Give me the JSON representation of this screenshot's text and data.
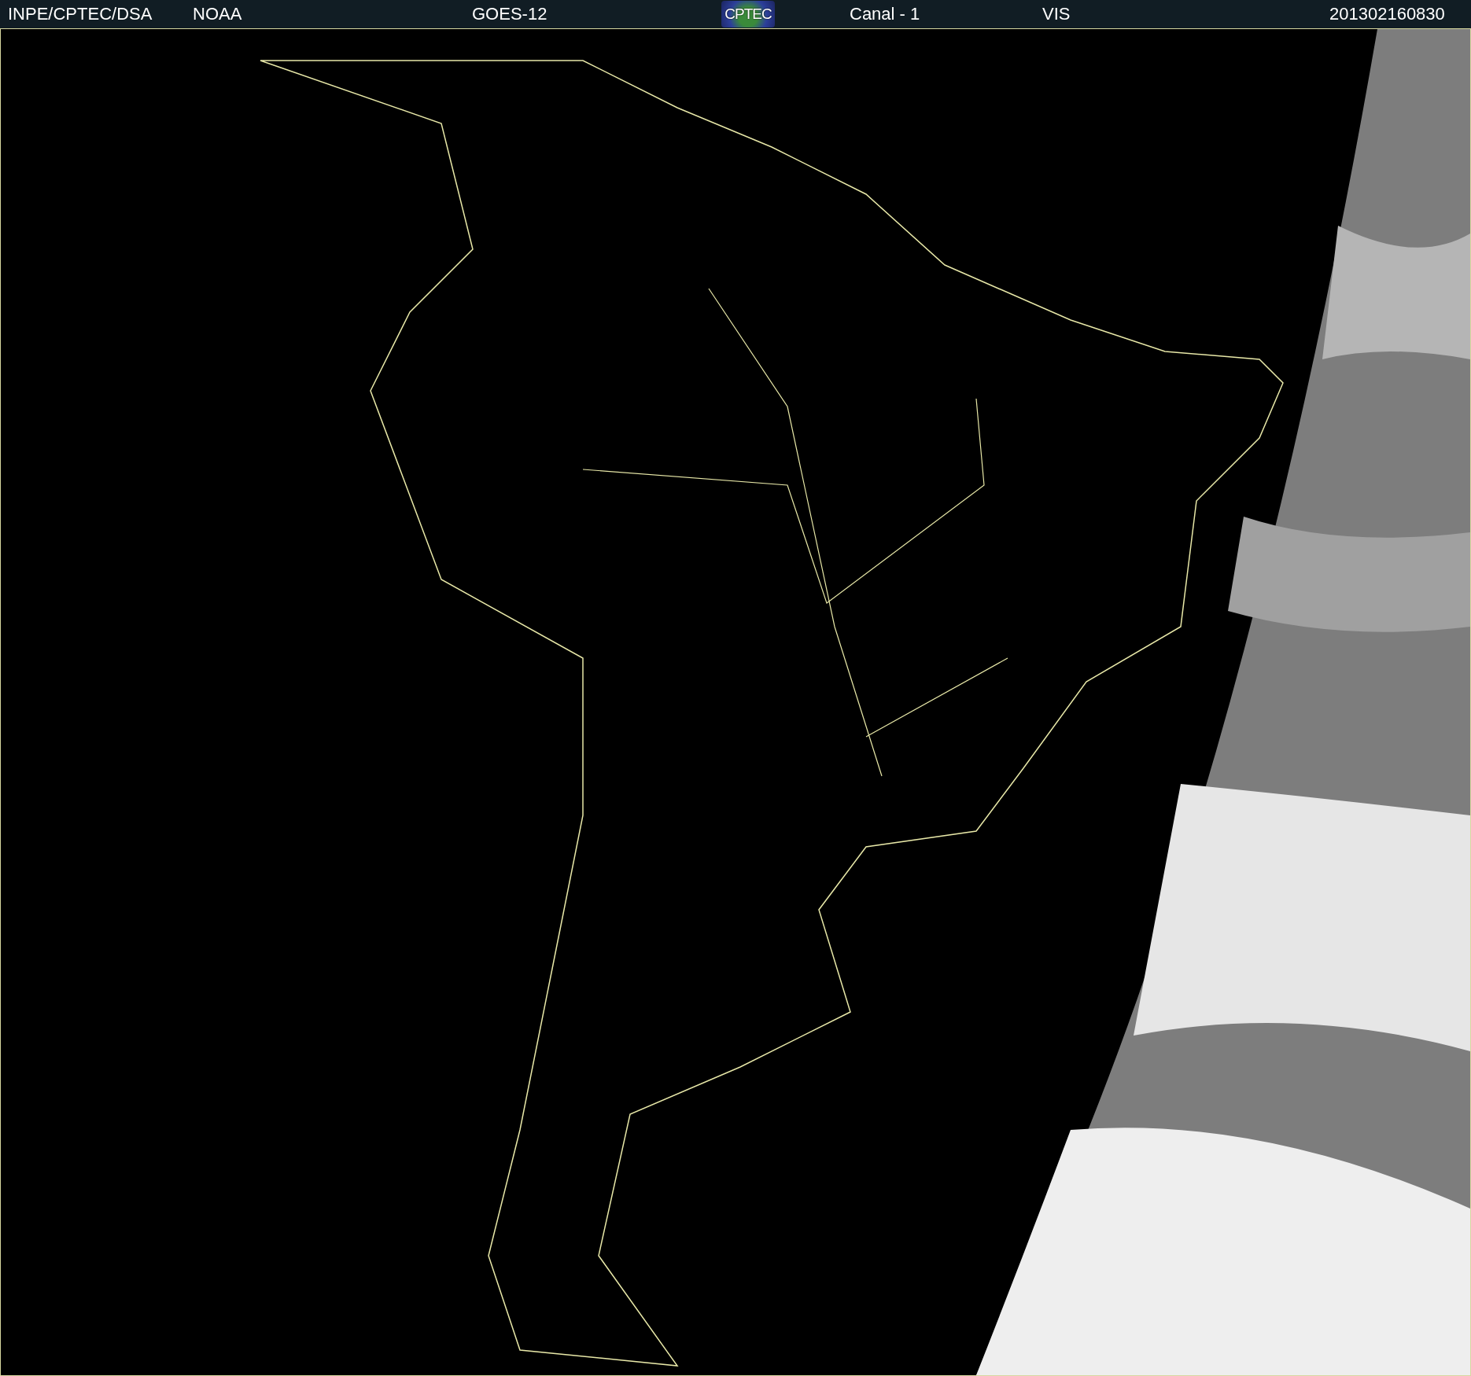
{
  "header": {
    "items": [
      {
        "kind": "text",
        "label": "INPE/CPTEC/DSA"
      },
      {
        "kind": "text",
        "label": "NOAA"
      },
      {
        "kind": "text",
        "label": "GOES-12"
      },
      {
        "kind": "logo",
        "label": "CPTEC"
      },
      {
        "kind": "text",
        "label": "Canal - 1"
      },
      {
        "kind": "text",
        "label": "VIS"
      },
      {
        "kind": "text",
        "label": "201302160830"
      }
    ]
  }
}
